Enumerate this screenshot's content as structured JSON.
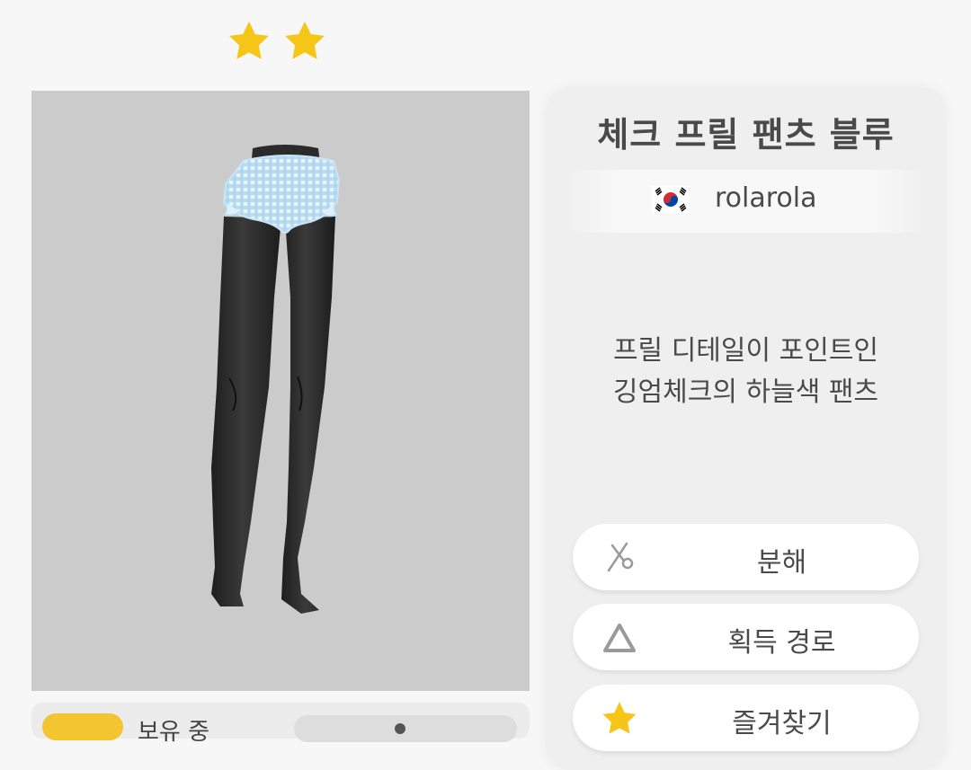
{
  "rarity": {
    "stars": 2,
    "star_color": "#f5c518"
  },
  "preview": {
    "background": "#cbcbcb",
    "item_icon": "check-frill-pants-model"
  },
  "bottom_bar": {
    "owned_label": "보유 중"
  },
  "item": {
    "title": "체크 프릴 팬츠 블루",
    "creator": {
      "flag_icon": "south-korea-flag-icon",
      "name": "rolarola"
    },
    "description_lines": [
      "프릴 디테일이 포인트인",
      "깅엄체크의 하늘색 팬츠"
    ]
  },
  "actions": [
    {
      "label": "분해",
      "icon": "scissors-icon"
    },
    {
      "label": "획득 경로",
      "icon": "triangle-icon"
    },
    {
      "label": "즐겨찾기",
      "icon": "star-icon"
    }
  ],
  "colors": {
    "accent": "#f5c518",
    "text": "#4a4a4a",
    "panel": "#efefef"
  }
}
